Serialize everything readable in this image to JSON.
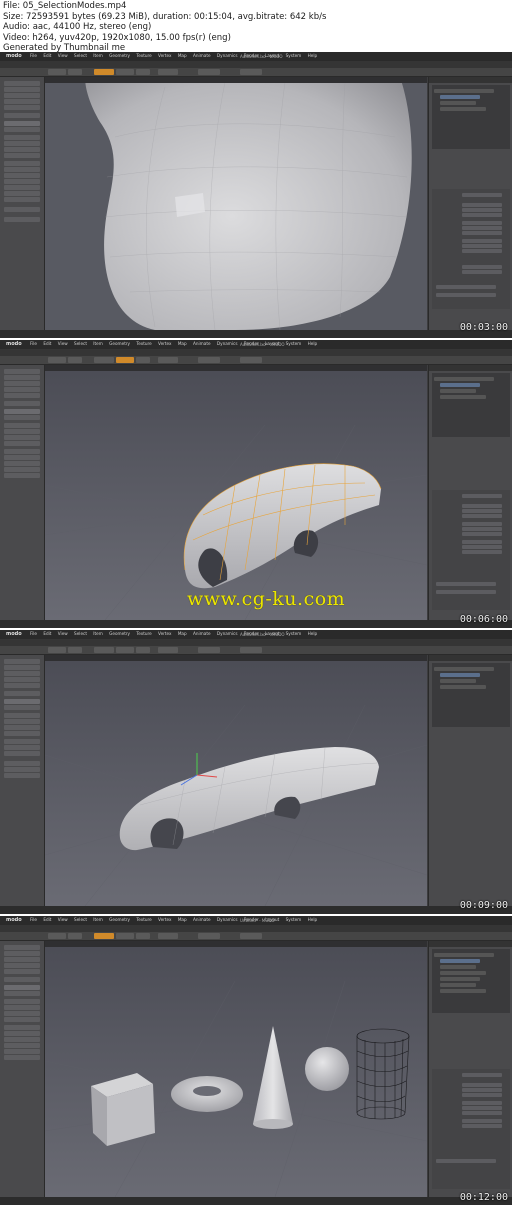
{
  "thumbnail_info": {
    "file_line": "File: 05_SelectionModes.mp4",
    "size_line": "Size: 72593591 bytes (69.23 MiB), duration: 00:15:04, avg.bitrate: 642 kb/s",
    "audio_line": "Audio: aac, 44100 Hz, stereo (eng)",
    "video_line": "Video: h264, yuv420p, 1920x1080, 15.00 fps(r) (eng)",
    "generated_line": "Generated by Thumbnail me"
  },
  "app": {
    "logo": "modo",
    "menus": [
      "File",
      "Edit",
      "View",
      "Select",
      "Item",
      "Geometry",
      "Texture",
      "Vertex Map",
      "Animate",
      "Dynamics",
      "Render",
      "Layout",
      "System",
      "Help"
    ]
  },
  "frames": [
    {
      "window_title": "AudiShell.lxo - MODO",
      "timestamp": "00:03:00"
    },
    {
      "window_title": "AudiShell.lxo* - MODO",
      "timestamp": "00:06:00"
    },
    {
      "window_title": "AudiShell.lxo* - MODO",
      "timestamp": "00:09:00"
    },
    {
      "window_title": "Untitled* - MODO",
      "timestamp": "00:12:00"
    }
  ],
  "watermark": "www.cg-ku.com",
  "colors": {
    "viewport_bg": "#55565e",
    "mesh": "#c4c4c8",
    "selection": "#e8a43a",
    "watermark": "#ece600"
  }
}
